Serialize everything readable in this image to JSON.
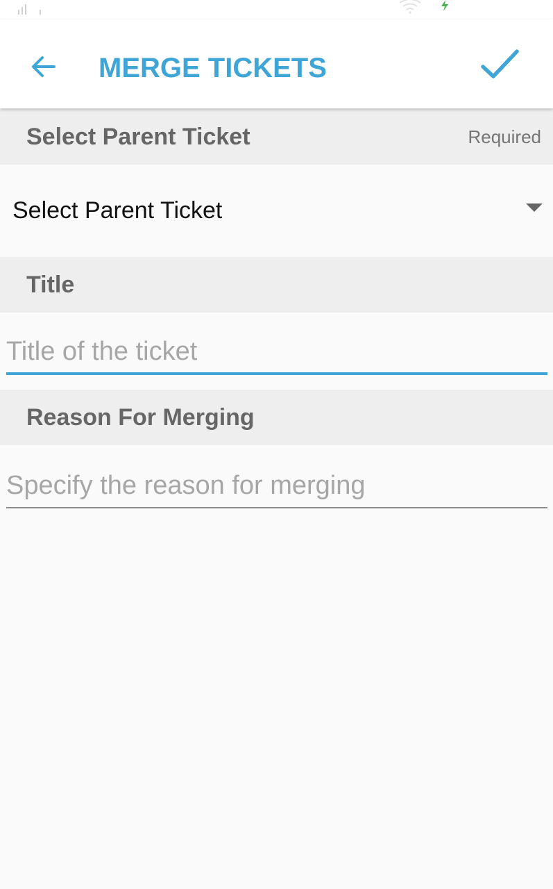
{
  "status_bar": {
    "icons": [
      "signal-icon",
      "wifi-icon",
      "charging-icon"
    ],
    "charging_color": "#4caf50"
  },
  "app_bar": {
    "title": "MERGE TICKETS",
    "back_icon": "arrow-left-icon",
    "confirm_icon": "checkmark-icon",
    "accent_color": "#3fa4d6"
  },
  "sections": {
    "parent_ticket": {
      "header": "Select Parent Ticket",
      "required_label": "Required",
      "selected_value": "Select Parent Ticket",
      "dropdown_icon": "dropdown-triangle-icon"
    },
    "title": {
      "header": "Title",
      "value": "",
      "placeholder": "Title of the ticket"
    },
    "reason": {
      "header": "Reason For Merging",
      "value": "",
      "placeholder": "Specify the reason for merging"
    }
  }
}
